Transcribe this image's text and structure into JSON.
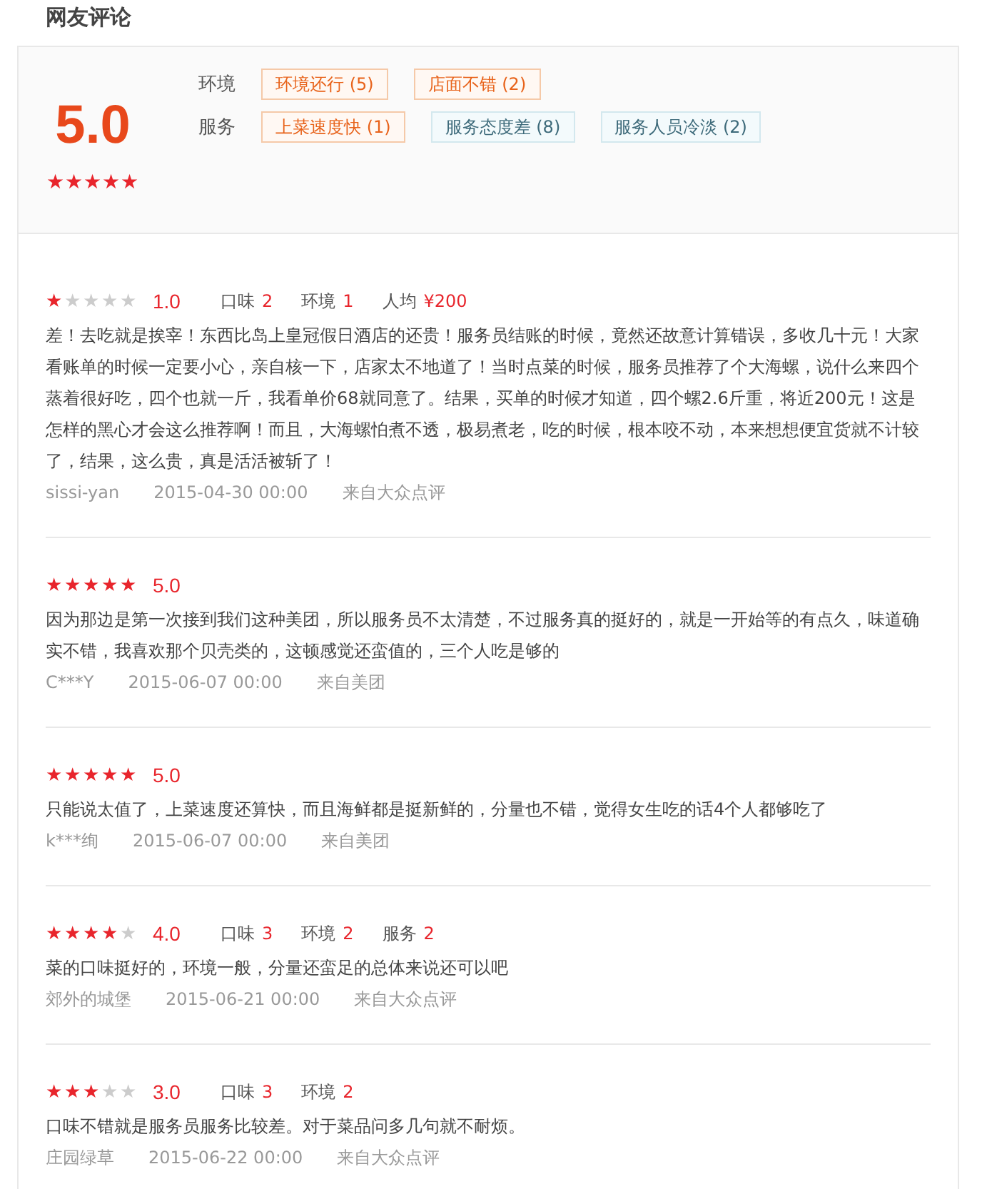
{
  "title": "网友评论",
  "summary": {
    "score": "5.0",
    "stars": 5,
    "groups": [
      {
        "label": "环境",
        "tags": [
          {
            "text": "环境还行 (5)",
            "kind": "positive"
          },
          {
            "text": "店面不错 (2)",
            "kind": "positive"
          }
        ]
      },
      {
        "label": "服务",
        "tags": [
          {
            "text": "上菜速度快 (1)",
            "kind": "positive"
          },
          {
            "text": "服务态度差 (8)",
            "kind": "negative"
          },
          {
            "text": "服务人员冷淡 (2)",
            "kind": "negative"
          }
        ]
      }
    ]
  },
  "reviews": [
    {
      "stars": 1,
      "score": "1.0",
      "details": [
        {
          "label": "口味",
          "value": "2"
        },
        {
          "label": "环境",
          "value": "1"
        },
        {
          "label": "人均",
          "value": "¥200"
        }
      ],
      "text": "差！去吃就是挨宰！东西比岛上皇冠假日酒店的还贵！服务员结账的时候，竟然还故意计算错误，多收几十元！大家看账单的时候一定要小心，亲自核一下，店家太不地道了！当时点菜的时候，服务员推荐了个大海螺，说什么来四个蒸着很好吃，四个也就一斤，我看单价68就同意了。结果，买单的时候才知道，四个螺2.6斤重，将近200元！这是怎样的黑心才会这么推荐啊！而且，大海螺怕煮不透，极易煮老，吃的时候，根本咬不动，本来想想便宜货就不计较了，结果，这么贵，真是活活被斩了！",
      "user": "sissi-yan",
      "date": "2015-04-30 00:00",
      "source": "来自大众点评"
    },
    {
      "stars": 5,
      "score": "5.0",
      "text": "因为那边是第一次接到我们这种美团，所以服务员不太清楚，不过服务真的挺好的，就是一开始等的有点久，味道确实不错，我喜欢那个贝壳类的，这顿感觉还蛮值的，三个人吃是够的",
      "user": "C***Y",
      "date": "2015-06-07 00:00",
      "source": "来自美团"
    },
    {
      "stars": 5,
      "score": "5.0",
      "text": "只能说太值了，上菜速度还算快，而且海鲜都是挺新鲜的，分量也不错，觉得女生吃的话4个人都够吃了",
      "user": "k***绚",
      "date": "2015-06-07 00:00",
      "source": "来自美团"
    },
    {
      "stars": 4,
      "score": "4.0",
      "details": [
        {
          "label": "口味",
          "value": "3"
        },
        {
          "label": "环境",
          "value": "2"
        },
        {
          "label": "服务",
          "value": "2"
        }
      ],
      "text": "菜的口味挺好的，环境一般，分量还蛮足的总体来说还可以吧",
      "user": "郊外的城堡",
      "date": "2015-06-21 00:00",
      "source": "来自大众点评"
    },
    {
      "stars": 3,
      "score": "3.0",
      "details": [
        {
          "label": "口味",
          "value": "3"
        },
        {
          "label": "环境",
          "value": "2"
        }
      ],
      "text": "口味不错就是服务员服务比较差。对于菜品问多几句就不耐烦。",
      "user": "庄园绿草",
      "date": "2015-06-22 00:00",
      "source": "来自大众点评"
    }
  ]
}
